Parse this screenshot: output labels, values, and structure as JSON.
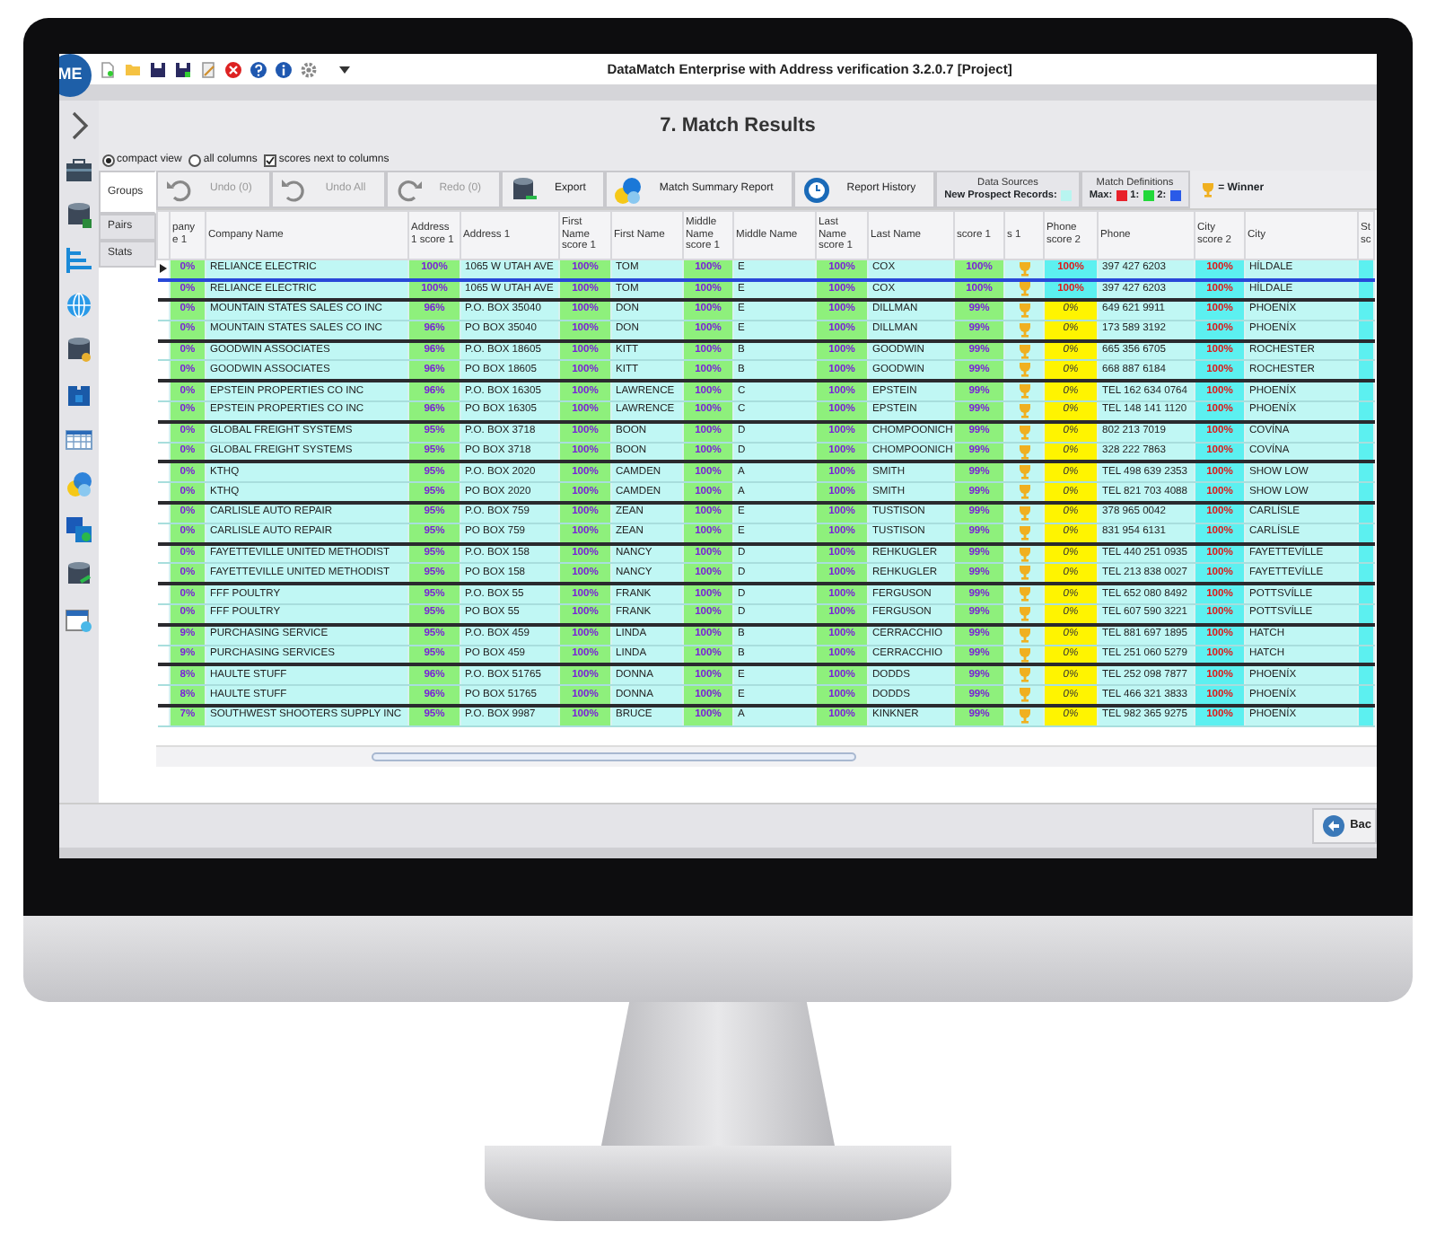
{
  "window": {
    "title": "DataMatch Enterprise with Address verification 3.2.0.7 [Project]",
    "logo_text": "ME"
  },
  "page_title": "7. Match Results",
  "view_options": [
    {
      "label": "compact view",
      "kind": "radio",
      "selected": true
    },
    {
      "label": "all columns",
      "kind": "radio",
      "selected": false
    },
    {
      "label": "scores next to columns",
      "kind": "checkbox",
      "selected": true
    }
  ],
  "side_tabs": [
    {
      "label": "Groups",
      "selected": true
    },
    {
      "label": "Pairs",
      "selected": false
    },
    {
      "label": "Stats",
      "selected": false
    }
  ],
  "toolbar": [
    {
      "label": "Undo (0)",
      "kind": "undo",
      "disabled": true
    },
    {
      "label": "Undo All",
      "kind": "undo_all",
      "disabled": true
    },
    {
      "label": "Redo (0)",
      "kind": "redo",
      "disabled": true
    },
    {
      "label": "Export",
      "kind": "export",
      "disabled": false
    },
    {
      "label": "Match Summary Report",
      "kind": "summary",
      "disabled": false
    },
    {
      "label": "Report History",
      "kind": "history",
      "disabled": false
    }
  ],
  "data_sources": {
    "title": "Data Sources",
    "items": [
      {
        "label": "New Prospect Records:",
        "color": "#b8f5f0"
      }
    ]
  },
  "match_definitions": {
    "title": "Match Definitions",
    "items": [
      {
        "label": "Max:",
        "color": "#e8202a"
      },
      {
        "label": "1:",
        "color": "#22d83a"
      },
      {
        "label": "2:",
        "color": "#2a5ae8"
      }
    ]
  },
  "winner_legend": "= Winner",
  "table": {
    "columns": [
      {
        "label": "pany e 1",
        "kind": "score"
      },
      {
        "label": "Company Name",
        "kind": "text"
      },
      {
        "label": "Address 1 score 1",
        "kind": "score"
      },
      {
        "label": "Address 1",
        "kind": "text"
      },
      {
        "label": "First Name score 1",
        "kind": "score"
      },
      {
        "label": "First Name",
        "kind": "text"
      },
      {
        "label": "Middle Name score 1",
        "kind": "score"
      },
      {
        "label": "Middle Name",
        "kind": "text"
      },
      {
        "label": "Last Name score 1",
        "kind": "score"
      },
      {
        "label": "Last Name",
        "kind": "text"
      },
      {
        "label": "score 1",
        "kind": "score"
      },
      {
        "label": "s 1",
        "kind": "trophy"
      },
      {
        "label": "Phone score 2",
        "kind": "phone_score"
      },
      {
        "label": "Phone",
        "kind": "text"
      },
      {
        "label": "City score 2",
        "kind": "city_score"
      },
      {
        "label": "City",
        "kind": "text"
      },
      {
        "label": "St sc",
        "kind": "stub"
      }
    ],
    "groups": [
      {
        "rows": [
          {
            "selected": true,
            "winner": true,
            "phone_match": true,
            "cells": [
              "0%",
              "RELIANCE ELECTRIC",
              "100%",
              "1065 W UTAH AVE",
              "100%",
              "TOM",
              "100%",
              "E",
              "100%",
              "COX",
              "100%",
              "100%",
              "397 427 6203",
              "100%",
              "HÍLDALE"
            ]
          },
          {
            "selected": false,
            "winner": true,
            "phone_match": true,
            "cells": [
              "0%",
              "RELIANCE ELECTRIC",
              "100%",
              "1065 W UTAH AVE",
              "100%",
              "TOM",
              "100%",
              "E",
              "100%",
              "COX",
              "100%",
              "100%",
              "397 427 6203",
              "100%",
              "HÍLDALE"
            ]
          }
        ]
      },
      {
        "rows": [
          {
            "selected": false,
            "winner": true,
            "phone_match": false,
            "cells": [
              "0%",
              "MOUNTAIN STATES SALES CO INC",
              "96%",
              "P.O. BOX 35040",
              "100%",
              "DON",
              "100%",
              "E",
              "100%",
              "DILLMAN",
              "99%",
              "0%",
              "649 621 9911",
              "100%",
              "PHOENÍX"
            ]
          },
          {
            "selected": false,
            "winner": true,
            "phone_match": false,
            "cells": [
              "0%",
              "MOUNTAIN STATES SALES CO INC",
              "96%",
              "PO BOX 35040",
              "100%",
              "DON",
              "100%",
              "E",
              "100%",
              "DILLMAN",
              "99%",
              "0%",
              "173 589 3192",
              "100%",
              "PHOENÍX"
            ]
          }
        ]
      },
      {
        "rows": [
          {
            "selected": false,
            "winner": true,
            "phone_match": false,
            "cells": [
              "0%",
              "GOODWIN ASSOCIATES",
              "96%",
              "P.O. BOX 18605",
              "100%",
              "KITT",
              "100%",
              "B",
              "100%",
              "GOODWIN",
              "99%",
              "0%",
              "665 356 6705",
              "100%",
              "ROCHESTER"
            ]
          },
          {
            "selected": false,
            "winner": true,
            "phone_match": false,
            "cells": [
              "0%",
              "GOODWIN ASSOCIATES",
              "96%",
              "PO BOX 18605",
              "100%",
              "KITT",
              "100%",
              "B",
              "100%",
              "GOODWIN",
              "99%",
              "0%",
              "668 887 6184",
              "100%",
              "ROCHESTER"
            ]
          }
        ]
      },
      {
        "rows": [
          {
            "selected": false,
            "winner": true,
            "phone_match": false,
            "cells": [
              "0%",
              "EPSTEIN PROPERTIES CO INC",
              "96%",
              "P.O. BOX 16305",
              "100%",
              "LAWRENCE",
              "100%",
              "C",
              "100%",
              "EPSTEIN",
              "99%",
              "0%",
              "TEL 162 634 0764",
              "100%",
              "PHOENÍX"
            ]
          },
          {
            "selected": false,
            "winner": true,
            "phone_match": false,
            "cells": [
              "0%",
              "EPSTEIN PROPERTIES CO INC",
              "96%",
              "PO BOX 16305",
              "100%",
              "LAWRENCE",
              "100%",
              "C",
              "100%",
              "EPSTEIN",
              "99%",
              "0%",
              "TEL 148 141 1120",
              "100%",
              "PHOENÍX"
            ]
          }
        ]
      },
      {
        "rows": [
          {
            "selected": false,
            "winner": true,
            "phone_match": false,
            "cells": [
              "0%",
              "GLOBAL FREIGHT SYSTEMS",
              "95%",
              "P.O. BOX 3718",
              "100%",
              "BOON",
              "100%",
              "D",
              "100%",
              "CHOMPOONICH",
              "99%",
              "0%",
              "802 213 7019",
              "100%",
              "COVÍNA"
            ]
          },
          {
            "selected": false,
            "winner": true,
            "phone_match": false,
            "cells": [
              "0%",
              "GLOBAL FREIGHT SYSTEMS",
              "95%",
              "PO BOX 3718",
              "100%",
              "BOON",
              "100%",
              "D",
              "100%",
              "CHOMPOONICH",
              "99%",
              "0%",
              "328 222 7863",
              "100%",
              "COVÍNA"
            ]
          }
        ]
      },
      {
        "rows": [
          {
            "selected": false,
            "winner": true,
            "phone_match": false,
            "cells": [
              "0%",
              "KTHQ",
              "95%",
              "P.O. BOX 2020",
              "100%",
              "CAMDEN",
              "100%",
              "A",
              "100%",
              "SMITH",
              "99%",
              "0%",
              "TEL 498 639 2353",
              "100%",
              "SHOW LOW"
            ]
          },
          {
            "selected": false,
            "winner": true,
            "phone_match": false,
            "cells": [
              "0%",
              "KTHQ",
              "95%",
              "PO BOX 2020",
              "100%",
              "CAMDEN",
              "100%",
              "A",
              "100%",
              "SMITH",
              "99%",
              "0%",
              "TEL 821 703 4088",
              "100%",
              "SHOW LOW"
            ]
          }
        ]
      },
      {
        "rows": [
          {
            "selected": false,
            "winner": true,
            "phone_match": false,
            "cells": [
              "0%",
              "CARLISLE AUTO REPAIR",
              "95%",
              "P.O. BOX 759",
              "100%",
              "ZEAN",
              "100%",
              "E",
              "100%",
              "TUSTISON",
              "99%",
              "0%",
              "378 965 0042",
              "100%",
              "CARLÍSLE"
            ]
          },
          {
            "selected": false,
            "winner": true,
            "phone_match": false,
            "cells": [
              "0%",
              "CARLISLE AUTO REPAIR",
              "95%",
              "PO BOX 759",
              "100%",
              "ZEAN",
              "100%",
              "E",
              "100%",
              "TUSTISON",
              "99%",
              "0%",
              "831 954 6131",
              "100%",
              "CARLÍSLE"
            ]
          }
        ]
      },
      {
        "rows": [
          {
            "selected": false,
            "winner": true,
            "phone_match": false,
            "cells": [
              "0%",
              "FAYETTEVILLE UNITED METHODIST",
              "95%",
              "P.O. BOX 158",
              "100%",
              "NANCY",
              "100%",
              "D",
              "100%",
              "REHKUGLER",
              "99%",
              "0%",
              "TEL 440 251 0935",
              "100%",
              "FAYETTEVÍLLE"
            ]
          },
          {
            "selected": false,
            "winner": true,
            "phone_match": false,
            "cells": [
              "0%",
              "FAYETTEVILLE UNITED METHODIST",
              "95%",
              "PO BOX 158",
              "100%",
              "NANCY",
              "100%",
              "D",
              "100%",
              "REHKUGLER",
              "99%",
              "0%",
              "TEL 213 838 0027",
              "100%",
              "FAYETTEVÍLLE"
            ]
          }
        ]
      },
      {
        "rows": [
          {
            "selected": false,
            "winner": true,
            "phone_match": false,
            "cells": [
              "0%",
              "FFF POULTRY",
              "95%",
              "P.O. BOX 55",
              "100%",
              "FRANK",
              "100%",
              "D",
              "100%",
              "FERGUSON",
              "99%",
              "0%",
              "TEL 652 080 8492",
              "100%",
              "POTTSVÍLLE"
            ]
          },
          {
            "selected": false,
            "winner": true,
            "phone_match": false,
            "cells": [
              "0%",
              "FFF POULTRY",
              "95%",
              "PO BOX 55",
              "100%",
              "FRANK",
              "100%",
              "D",
              "100%",
              "FERGUSON",
              "99%",
              "0%",
              "TEL 607 590 3221",
              "100%",
              "POTTSVÍLLE"
            ]
          }
        ]
      },
      {
        "rows": [
          {
            "selected": false,
            "winner": true,
            "phone_match": false,
            "cells": [
              "9%",
              "PURCHASING SERVICE",
              "95%",
              "P.O. BOX 459",
              "100%",
              "LINDA",
              "100%",
              "B",
              "100%",
              "CERRACCHIO",
              "99%",
              "0%",
              "TEL 881 697 1895",
              "100%",
              "HATCH"
            ]
          },
          {
            "selected": false,
            "winner": true,
            "phone_match": false,
            "cells": [
              "9%",
              "PURCHASING SERVICES",
              "95%",
              "PO BOX 459",
              "100%",
              "LINDA",
              "100%",
              "B",
              "100%",
              "CERRACCHIO",
              "99%",
              "0%",
              "TEL 251 060 5279",
              "100%",
              "HATCH"
            ]
          }
        ]
      },
      {
        "rows": [
          {
            "selected": false,
            "winner": true,
            "phone_match": false,
            "cells": [
              "8%",
              "HAULTE STUFF",
              "96%",
              "P.O. BOX 51765",
              "100%",
              "DONNA",
              "100%",
              "E",
              "100%",
              "DODDS",
              "99%",
              "0%",
              "TEL 252 098 7877",
              "100%",
              "PHOENÍX"
            ]
          },
          {
            "selected": false,
            "winner": true,
            "phone_match": false,
            "cells": [
              "8%",
              "HAULTE STUFF",
              "96%",
              "PO BOX 51765",
              "100%",
              "DONNA",
              "100%",
              "E",
              "100%",
              "DODDS",
              "99%",
              "0%",
              "TEL 466 321 3833",
              "100%",
              "PHOENÍX"
            ]
          }
        ]
      },
      {
        "rows": [
          {
            "selected": false,
            "winner": true,
            "phone_match": false,
            "cells": [
              "7%",
              "SOUTHWEST SHOOTERS SUPPLY INC",
              "95%",
              "P.O. BOX 9987",
              "100%",
              "BRUCE",
              "100%",
              "A",
              "100%",
              "KINKNER",
              "99%",
              "0%",
              "TEL 982 365 9275",
              "100%",
              "PHOENÍX"
            ]
          }
        ]
      }
    ]
  },
  "back_button": "Bac"
}
